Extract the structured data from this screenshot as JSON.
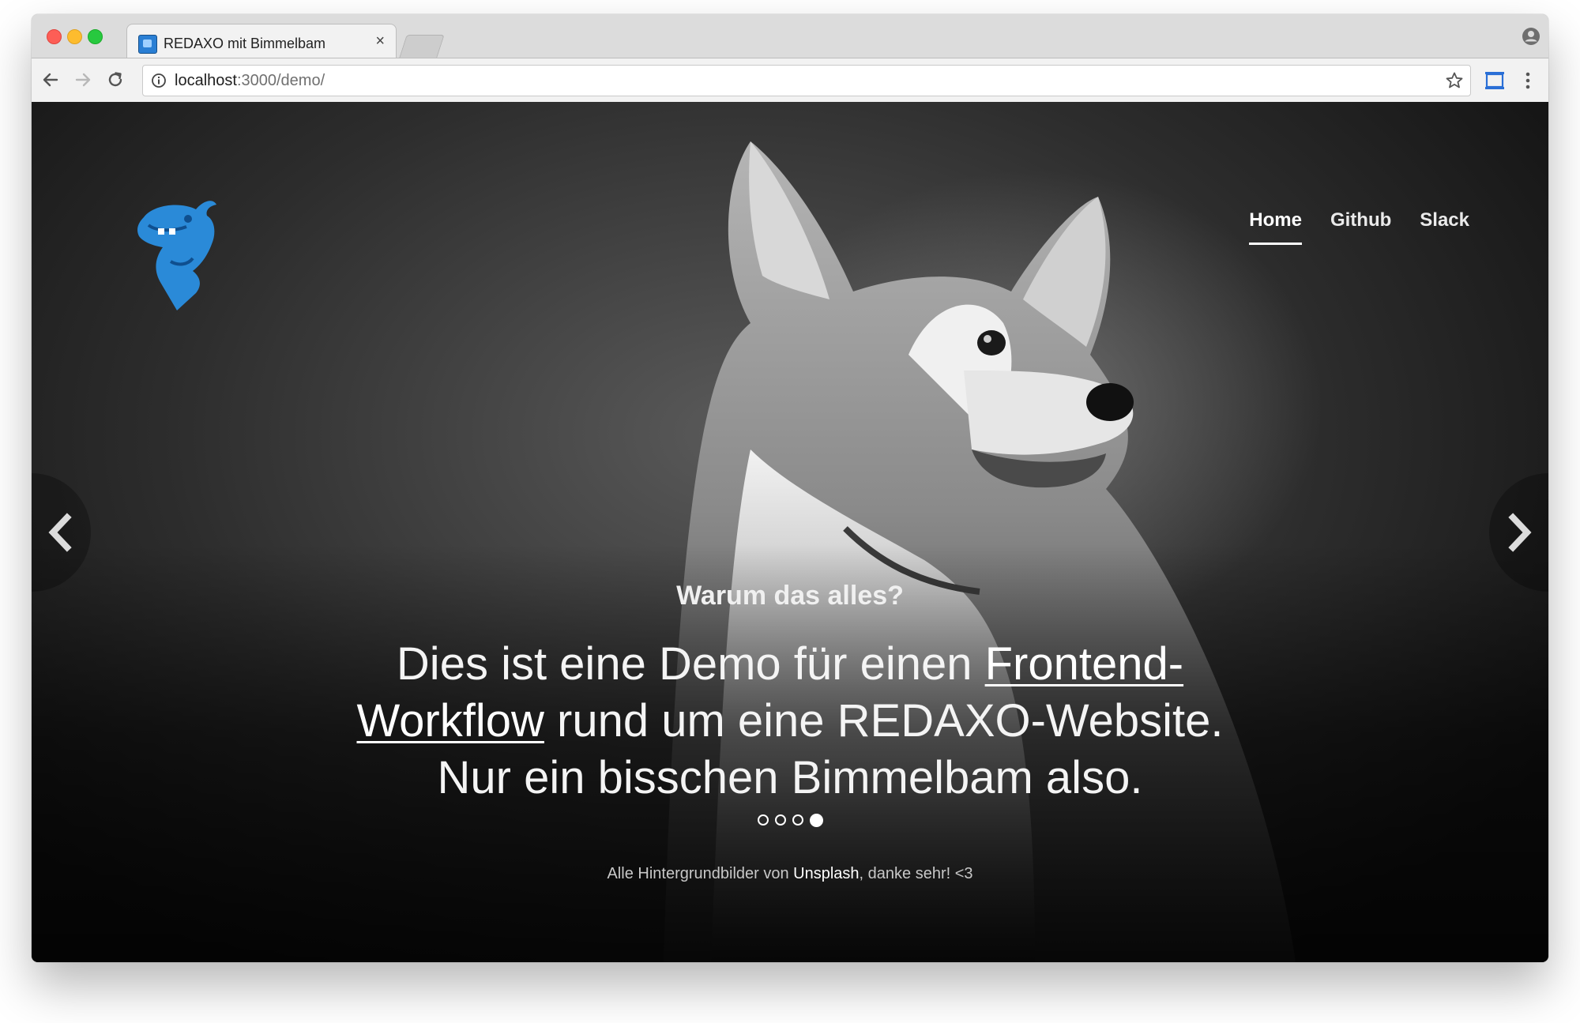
{
  "browser": {
    "tab_title": "REDAXO mit Bimmelbam",
    "tab_close": "×",
    "url_host": "localhost",
    "url_path": ":3000/demo/"
  },
  "site": {
    "nav": [
      {
        "label": "Home",
        "active": true
      },
      {
        "label": "Github",
        "active": false
      },
      {
        "label": "Slack",
        "active": false
      }
    ],
    "slide": {
      "subtitle": "Warum das alles?",
      "text_part1": "Dies ist eine Demo für einen ",
      "link_text": "Frontend-Workflow",
      "text_part2": " rund um eine REDAXO-Website. Nur ein bisschen Bimmelbam also."
    },
    "pager": {
      "count": 4,
      "active_index": 3
    },
    "credit": {
      "prefix": "Alle Hintergrundbilder von ",
      "link": "Unsplash",
      "suffix": ", danke sehr! <3"
    }
  },
  "colors": {
    "accent_blue": "#2a8ad8",
    "traffic_red": "#fd5e56",
    "traffic_yellow": "#fdbc2e",
    "traffic_green": "#27c93f"
  },
  "icons": [
    "back-arrow-icon",
    "forward-arrow-icon",
    "reload-icon",
    "info-icon",
    "star-icon",
    "cast-icon",
    "menu-dots-icon",
    "profile-icon",
    "chevron-left-icon",
    "chevron-right-icon",
    "dragon-logo-icon",
    "dog-photo"
  ]
}
